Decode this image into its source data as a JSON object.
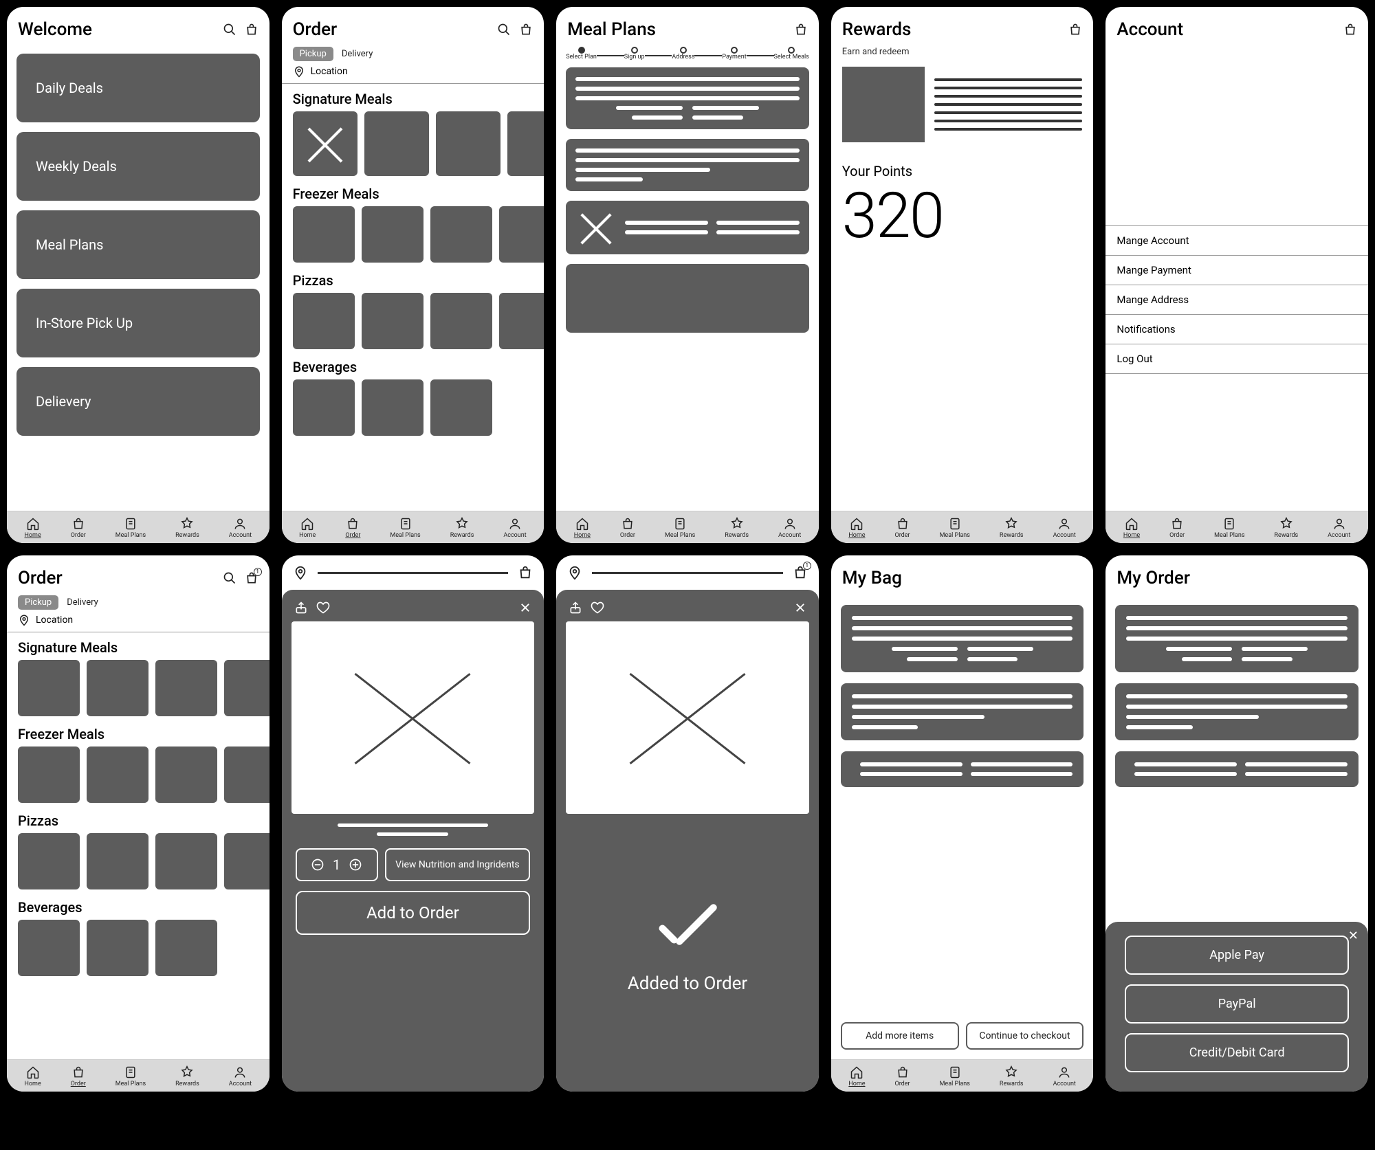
{
  "nav": {
    "home": "Home",
    "order": "Order",
    "meal_plans": "Meal Plans",
    "rewards": "Rewards",
    "account": "Account"
  },
  "welcome": {
    "title": "Welcome",
    "tiles": [
      "Daily Deals",
      "Weekly Deals",
      "Meal Plans",
      "In-Store Pick Up",
      "Delievery"
    ]
  },
  "order": {
    "title": "Order",
    "pickup": "Pickup",
    "delivery": "Delivery",
    "location": "Location",
    "categories": [
      "Signature Meals",
      "Freezer Meals",
      "Pizzas",
      "Beverages"
    ]
  },
  "meal_plans": {
    "title": "Meal Plans",
    "steps": [
      "Select Plan",
      "Sign up",
      "Address",
      "Payment",
      "Select Meals"
    ]
  },
  "rewards": {
    "title": "Rewards",
    "sub": "Earn and redeem",
    "points_label": "Your Points",
    "points_value": "320"
  },
  "account": {
    "title": "Account",
    "rows": [
      "Mange Account",
      "Mange Payment",
      "Mange Address",
      "Notifications",
      "Log Out"
    ]
  },
  "detail": {
    "qty": "1",
    "nutrition": "View Nutrition and Ingridents",
    "add": "Add to Order",
    "added": "Added to Order"
  },
  "bag": {
    "title": "My Bag",
    "add_more": "Add more items",
    "checkout": "Continue to checkout"
  },
  "my_order": {
    "title": "My Order",
    "pay": [
      "Apple Pay",
      "PayPal",
      "Credit/Debit Card"
    ]
  },
  "bag_badge": "1"
}
